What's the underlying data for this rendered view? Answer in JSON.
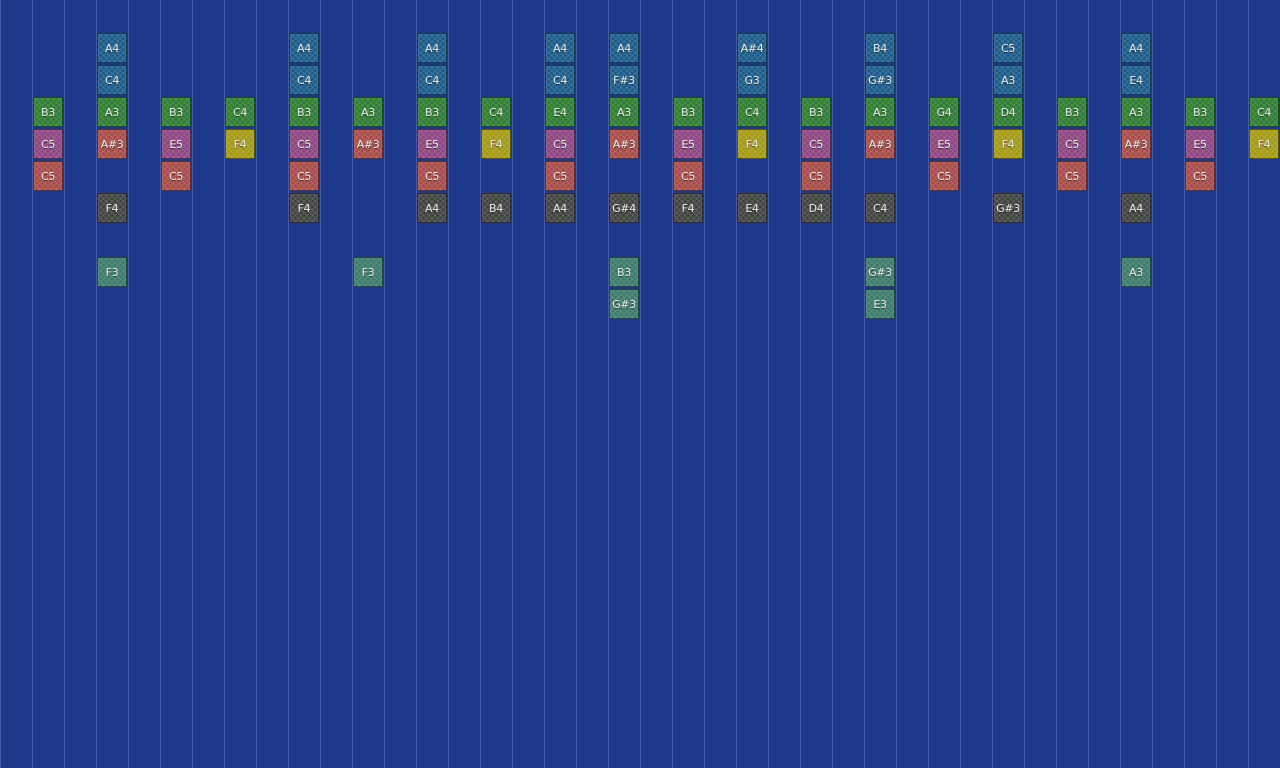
{
  "palette": {
    "background": "#1f3a8a",
    "gridline": "#5a6fb4",
    "blue": "#1b5c8a",
    "green": "#2e7d32",
    "pink": "#8e4582",
    "red": "#a84b48",
    "yellow": "#a49a14",
    "dark": "#424242",
    "teal": "#3c7a6a"
  },
  "columns": [
    {
      "notes": []
    },
    {
      "notes": [
        {
          "label": "B3",
          "color": "green"
        },
        {
          "label": "C5",
          "color": "pink"
        },
        {
          "label": "C5",
          "color": "red"
        }
      ]
    },
    {
      "notes": []
    },
    {
      "notes": [
        {
          "label": "A4",
          "color": "blue"
        },
        {
          "label": "C4",
          "color": "blue"
        },
        {
          "label": "A3",
          "color": "green"
        },
        {
          "label": "A#3",
          "color": "red"
        },
        {
          "label": "F4",
          "color": "dark"
        },
        {
          "label": "F3",
          "color": "teal"
        }
      ]
    },
    {
      "notes": []
    },
    {
      "notes": [
        {
          "label": "B3",
          "color": "green"
        },
        {
          "label": "E5",
          "color": "pink"
        },
        {
          "label": "C5",
          "color": "red"
        }
      ]
    },
    {
      "notes": []
    },
    {
      "notes": [
        {
          "label": "C4",
          "color": "green"
        },
        {
          "label": "F4",
          "color": "yellow"
        }
      ]
    },
    {
      "notes": []
    },
    {
      "notes": [
        {
          "label": "A4",
          "color": "blue"
        },
        {
          "label": "C4",
          "color": "blue"
        },
        {
          "label": "B3",
          "color": "green"
        },
        {
          "label": "C5",
          "color": "pink"
        },
        {
          "label": "C5",
          "color": "red"
        },
        {
          "label": "F4",
          "color": "dark"
        }
      ]
    },
    {
      "notes": []
    },
    {
      "notes": [
        {
          "label": "A3",
          "color": "green"
        },
        {
          "label": "A#3",
          "color": "red"
        },
        {
          "label": "F3",
          "color": "teal"
        }
      ]
    },
    {
      "notes": []
    },
    {
      "notes": [
        {
          "label": "A4",
          "color": "blue"
        },
        {
          "label": "C4",
          "color": "blue"
        },
        {
          "label": "B3",
          "color": "green"
        },
        {
          "label": "E5",
          "color": "pink"
        },
        {
          "label": "C5",
          "color": "red"
        },
        {
          "label": "A4",
          "color": "dark"
        }
      ]
    },
    {
      "notes": []
    },
    {
      "notes": [
        {
          "label": "C4",
          "color": "green"
        },
        {
          "label": "F4",
          "color": "yellow"
        },
        {
          "label": "B4",
          "color": "dark"
        }
      ]
    },
    {
      "notes": []
    },
    {
      "notes": [
        {
          "label": "A4",
          "color": "blue"
        },
        {
          "label": "C4",
          "color": "blue"
        },
        {
          "label": "E4",
          "color": "green"
        },
        {
          "label": "C5",
          "color": "pink"
        },
        {
          "label": "C5",
          "color": "red"
        },
        {
          "label": "A4",
          "color": "dark"
        }
      ]
    },
    {
      "notes": []
    },
    {
      "notes": [
        {
          "label": "A4",
          "color": "blue"
        },
        {
          "label": "F#3",
          "color": "blue"
        },
        {
          "label": "A3",
          "color": "green"
        },
        {
          "label": "A#3",
          "color": "red"
        },
        {
          "label": "G#4",
          "color": "dark"
        },
        {
          "label": "B3",
          "color": "teal"
        },
        {
          "label": "G#3",
          "color": "teal"
        }
      ]
    },
    {
      "notes": []
    },
    {
      "notes": [
        {
          "label": "B3",
          "color": "green"
        },
        {
          "label": "E5",
          "color": "pink"
        },
        {
          "label": "C5",
          "color": "red"
        },
        {
          "label": "F4",
          "color": "dark"
        }
      ]
    },
    {
      "notes": []
    },
    {
      "notes": [
        {
          "label": "A#4",
          "color": "blue"
        },
        {
          "label": "G3",
          "color": "blue"
        },
        {
          "label": "C4",
          "color": "green"
        },
        {
          "label": "F4",
          "color": "yellow"
        },
        {
          "label": "E4",
          "color": "dark"
        }
      ]
    },
    {
      "notes": []
    },
    {
      "notes": [
        {
          "label": "B3",
          "color": "green"
        },
        {
          "label": "C5",
          "color": "pink"
        },
        {
          "label": "C5",
          "color": "red"
        },
        {
          "label": "D4",
          "color": "dark"
        }
      ]
    },
    {
      "notes": []
    },
    {
      "notes": [
        {
          "label": "B4",
          "color": "blue"
        },
        {
          "label": "G#3",
          "color": "blue"
        },
        {
          "label": "A3",
          "color": "green"
        },
        {
          "label": "A#3",
          "color": "red"
        },
        {
          "label": "C4",
          "color": "dark"
        },
        {
          "label": "G#3",
          "color": "teal"
        },
        {
          "label": "E3",
          "color": "teal"
        }
      ]
    },
    {
      "notes": []
    },
    {
      "notes": [
        {
          "label": "G4",
          "color": "green"
        },
        {
          "label": "E5",
          "color": "pink"
        },
        {
          "label": "C5",
          "color": "red"
        }
      ]
    },
    {
      "notes": []
    },
    {
      "notes": [
        {
          "label": "C5",
          "color": "blue"
        },
        {
          "label": "A3",
          "color": "blue"
        },
        {
          "label": "D4",
          "color": "green"
        },
        {
          "label": "F4",
          "color": "yellow"
        },
        {
          "label": "G#3",
          "color": "dark"
        }
      ]
    },
    {
      "notes": []
    },
    {
      "notes": [
        {
          "label": "B3",
          "color": "green"
        },
        {
          "label": "C5",
          "color": "pink"
        },
        {
          "label": "C5",
          "color": "red"
        }
      ]
    },
    {
      "notes": []
    },
    {
      "notes": [
        {
          "label": "A4",
          "color": "blue"
        },
        {
          "label": "E4",
          "color": "blue"
        },
        {
          "label": "A3",
          "color": "green"
        },
        {
          "label": "A#3",
          "color": "red"
        },
        {
          "label": "A4",
          "color": "dark"
        },
        {
          "label": "A3",
          "color": "teal"
        }
      ]
    },
    {
      "notes": []
    },
    {
      "notes": [
        {
          "label": "B3",
          "color": "green"
        },
        {
          "label": "E5",
          "color": "pink"
        },
        {
          "label": "C5",
          "color": "red"
        }
      ]
    },
    {
      "notes": []
    },
    {
      "notes": [
        {
          "label": "C4",
          "color": "green"
        },
        {
          "label": "F4",
          "color": "yellow"
        }
      ]
    }
  ]
}
